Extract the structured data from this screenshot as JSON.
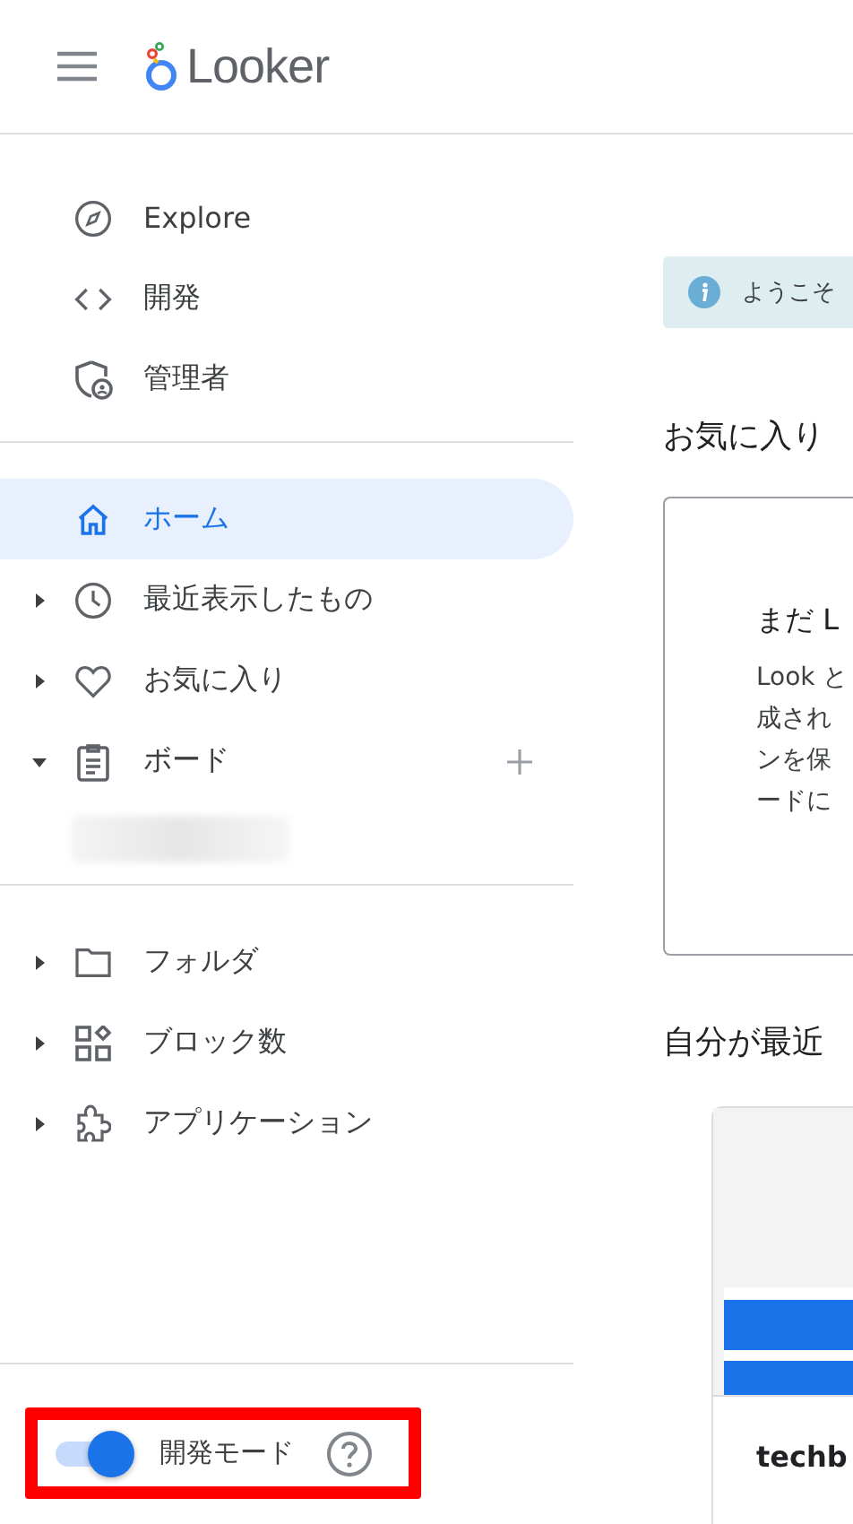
{
  "header": {
    "logo": "Looker"
  },
  "sidebar": {
    "top_items": [
      {
        "label": "Explore"
      },
      {
        "label": "開発"
      },
      {
        "label": "管理者"
      }
    ],
    "nav_items": [
      {
        "label": "ホーム",
        "selected": true
      },
      {
        "label": "最近表示したもの",
        "selected": false,
        "expanded": false
      },
      {
        "label": "お気に入り",
        "selected": false,
        "expanded": false
      },
      {
        "label": "ボード",
        "selected": false,
        "expanded": true,
        "addable": true
      }
    ],
    "content_items": [
      {
        "label": "フォルダ",
        "expanded": false
      },
      {
        "label": "ブロック数",
        "expanded": false
      },
      {
        "label": "アプリケーション",
        "expanded": false
      }
    ],
    "dev_mode": {
      "label": "開発モード",
      "on": true,
      "highlighted": true
    }
  },
  "main": {
    "banner": "ようこそ",
    "favorites_heading": "お気に入り",
    "empty_card": {
      "title": "まだ L",
      "lines": [
        "Look と",
        "成され",
        "ンを保",
        "ードに"
      ]
    },
    "recent_heading": "自分が最近",
    "recent_card": {
      "title": "techb"
    }
  }
}
